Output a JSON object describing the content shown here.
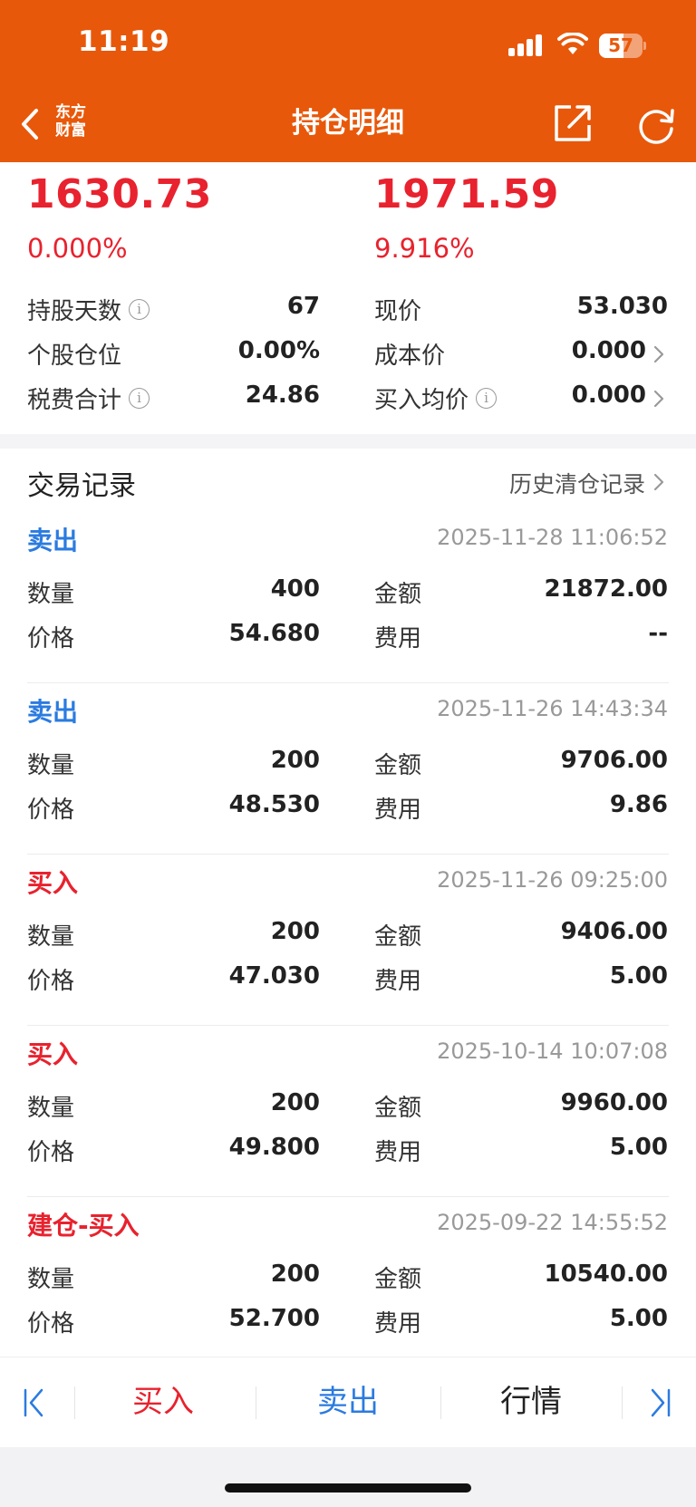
{
  "status_bar": {
    "time": "11:19",
    "battery": "57",
    "battery_level": 0.57
  },
  "nav": {
    "title": "持仓明细",
    "logo_line1": "东方",
    "logo_line2": "财富"
  },
  "summary": {
    "left_value": "1630.73",
    "left_pct": "0.000%",
    "right_value": "1971.59",
    "right_pct": "9.916%",
    "rows": [
      {
        "left_label": "持股天数",
        "left_value": "67",
        "right_label": "现价",
        "right_value": "53.030"
      },
      {
        "left_label": "个股仓位",
        "left_value": "0.00%",
        "right_label": "成本价",
        "right_value": "0.000"
      },
      {
        "left_label": "税费合计",
        "left_value": "24.86",
        "right_label": "买入均价",
        "right_value": "0.000"
      }
    ],
    "info_glyph": "i"
  },
  "trades_section": {
    "title": "交易记录",
    "history_link": "历史清仓记录"
  },
  "trades": [
    {
      "type": "卖出",
      "side": "sell",
      "time": "2025-11-28 11:06:52",
      "qty_label": "数量",
      "qty": "400",
      "amount_label": "金额",
      "amount": "21872.00",
      "price_label": "价格",
      "price": "54.680",
      "fee_label": "费用",
      "fee": "--"
    },
    {
      "type": "卖出",
      "side": "sell",
      "time": "2025-11-26 14:43:34",
      "qty_label": "数量",
      "qty": "200",
      "amount_label": "金额",
      "amount": "9706.00",
      "price_label": "价格",
      "price": "48.530",
      "fee_label": "费用",
      "fee": "9.86"
    },
    {
      "type": "买入",
      "side": "buy",
      "time": "2025-11-26 09:25:00",
      "qty_label": "数量",
      "qty": "200",
      "amount_label": "金额",
      "amount": "9406.00",
      "price_label": "价格",
      "price": "47.030",
      "fee_label": "费用",
      "fee": "5.00"
    },
    {
      "type": "买入",
      "side": "buy",
      "time": "2025-10-14 10:07:08",
      "qty_label": "数量",
      "qty": "200",
      "amount_label": "金额",
      "amount": "9960.00",
      "price_label": "价格",
      "price": "49.800",
      "fee_label": "费用",
      "fee": "5.00"
    },
    {
      "type": "建仓-买入",
      "side": "buy",
      "time": "2025-09-22 14:55:52",
      "qty_label": "数量",
      "qty": "200",
      "amount_label": "金额",
      "amount": "10540.00",
      "price_label": "价格",
      "price": "52.700",
      "fee_label": "费用",
      "fee": "5.00"
    }
  ],
  "toolbar": {
    "buy": "买入",
    "sell": "卖出",
    "quote": "行情"
  },
  "colors": {
    "header": "#E8580A",
    "up_red": "#E8222E",
    "sell_blue": "#2B7BE0",
    "buy_red": "#E8222E"
  }
}
